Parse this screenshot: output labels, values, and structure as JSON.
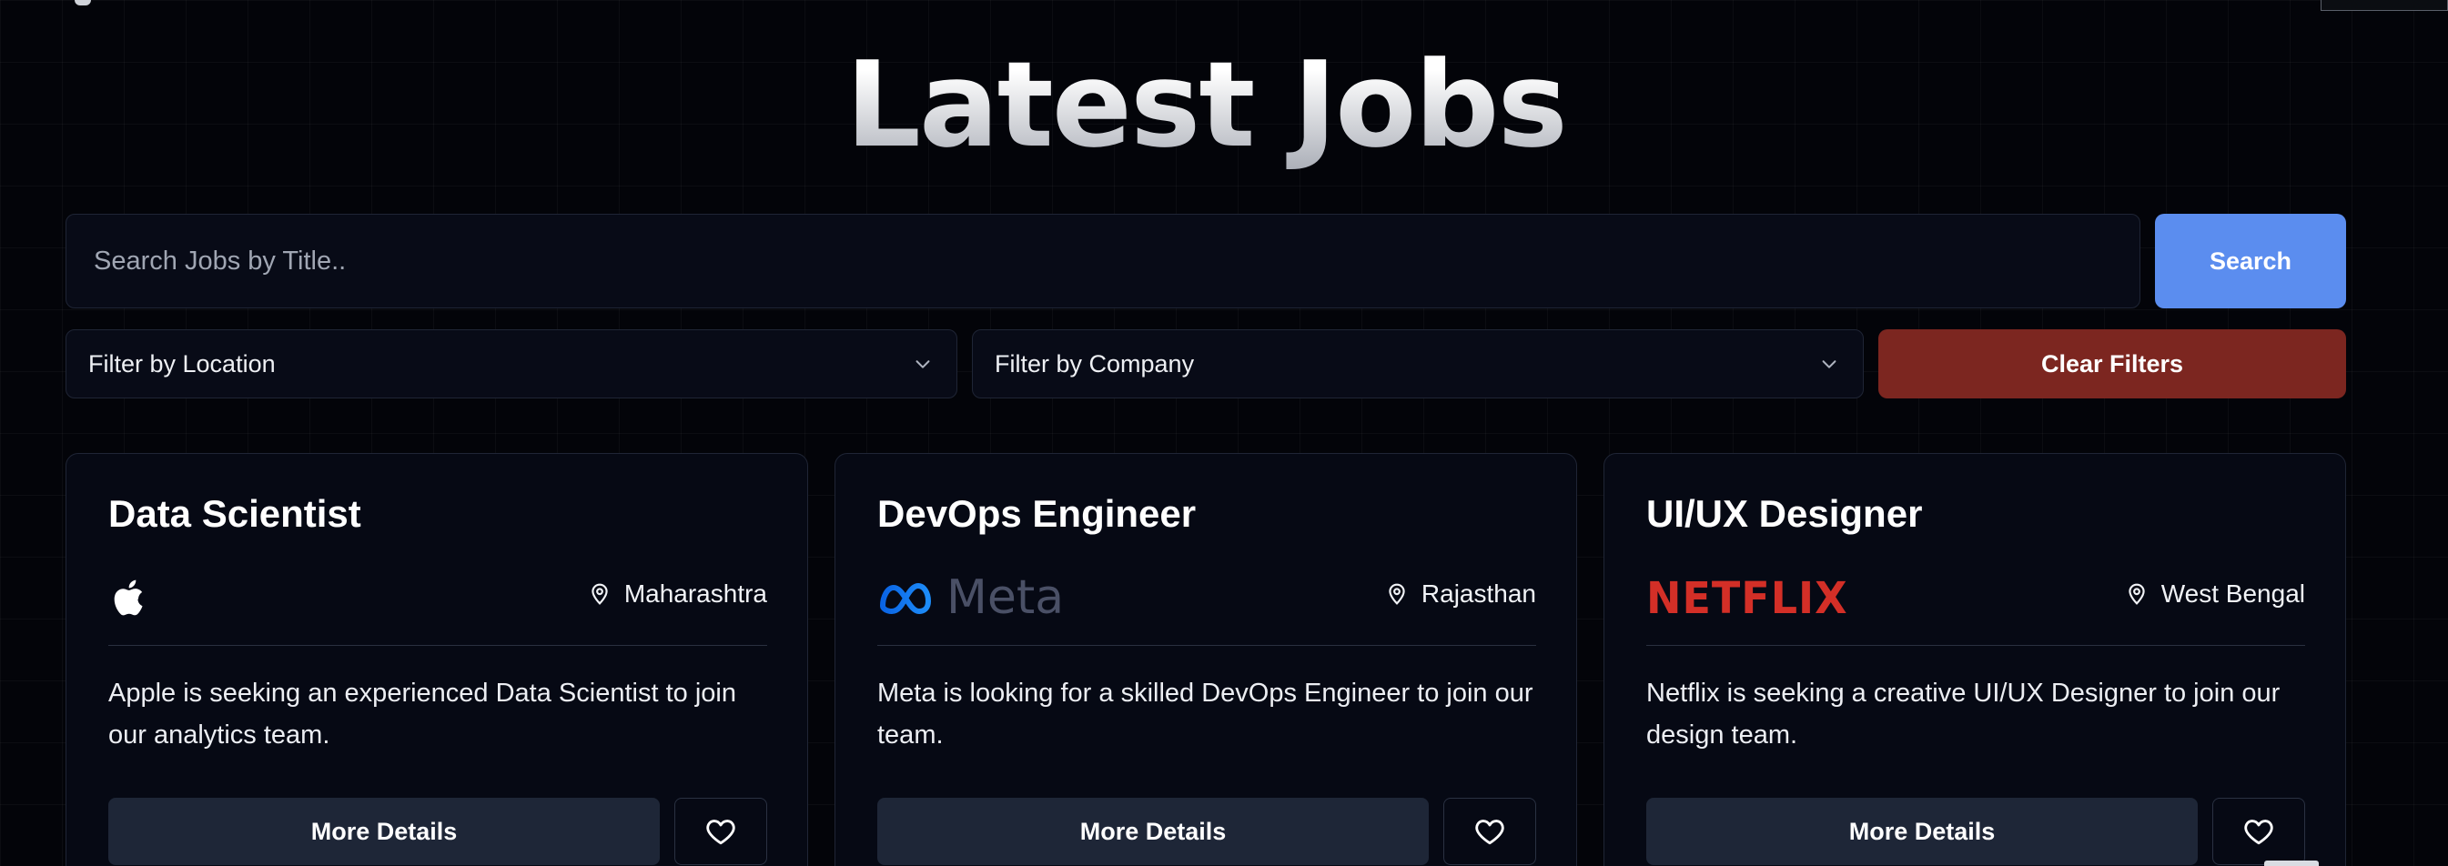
{
  "page": {
    "title": "Latest Jobs"
  },
  "search": {
    "placeholder": "Search Jobs by Title..",
    "value": "",
    "button_label": "Search"
  },
  "filters": {
    "location_placeholder": "Filter by Location",
    "company_placeholder": "Filter by Company",
    "clear_label": "Clear Filters"
  },
  "jobs": [
    {
      "title": "Data Scientist",
      "company": "Apple",
      "logo_icon": "apple-logo",
      "location": "Maharashtra",
      "description": "Apple is seeking an experienced Data Scientist to join our analytics team.",
      "details_label": "More Details"
    },
    {
      "title": "DevOps Engineer",
      "company": "Meta",
      "logo_icon": "meta-logo",
      "logo_text": "Meta",
      "location": "Rajasthan",
      "description": "Meta is looking for a skilled DevOps Engineer to join our team.",
      "details_label": "More Details"
    },
    {
      "title": "UI/UX Designer",
      "company": "Netflix",
      "logo_icon": "netflix-logo",
      "logo_text": "NETFLIX",
      "location": "West Bengal",
      "description": "Netflix is seeking a creative UI/UX Designer to join our design team.",
      "details_label": "More Details"
    }
  ],
  "icons": {
    "location": "map-pin-icon",
    "chevron": "chevron-down-icon",
    "favorite": "heart-icon"
  },
  "colors": {
    "background": "#030409",
    "search_button": "#5b8def",
    "clear_button": "#7c2620",
    "details_button": "#1e2637",
    "netflix_red": "#d32f27",
    "meta_blue": "#1877f2"
  }
}
